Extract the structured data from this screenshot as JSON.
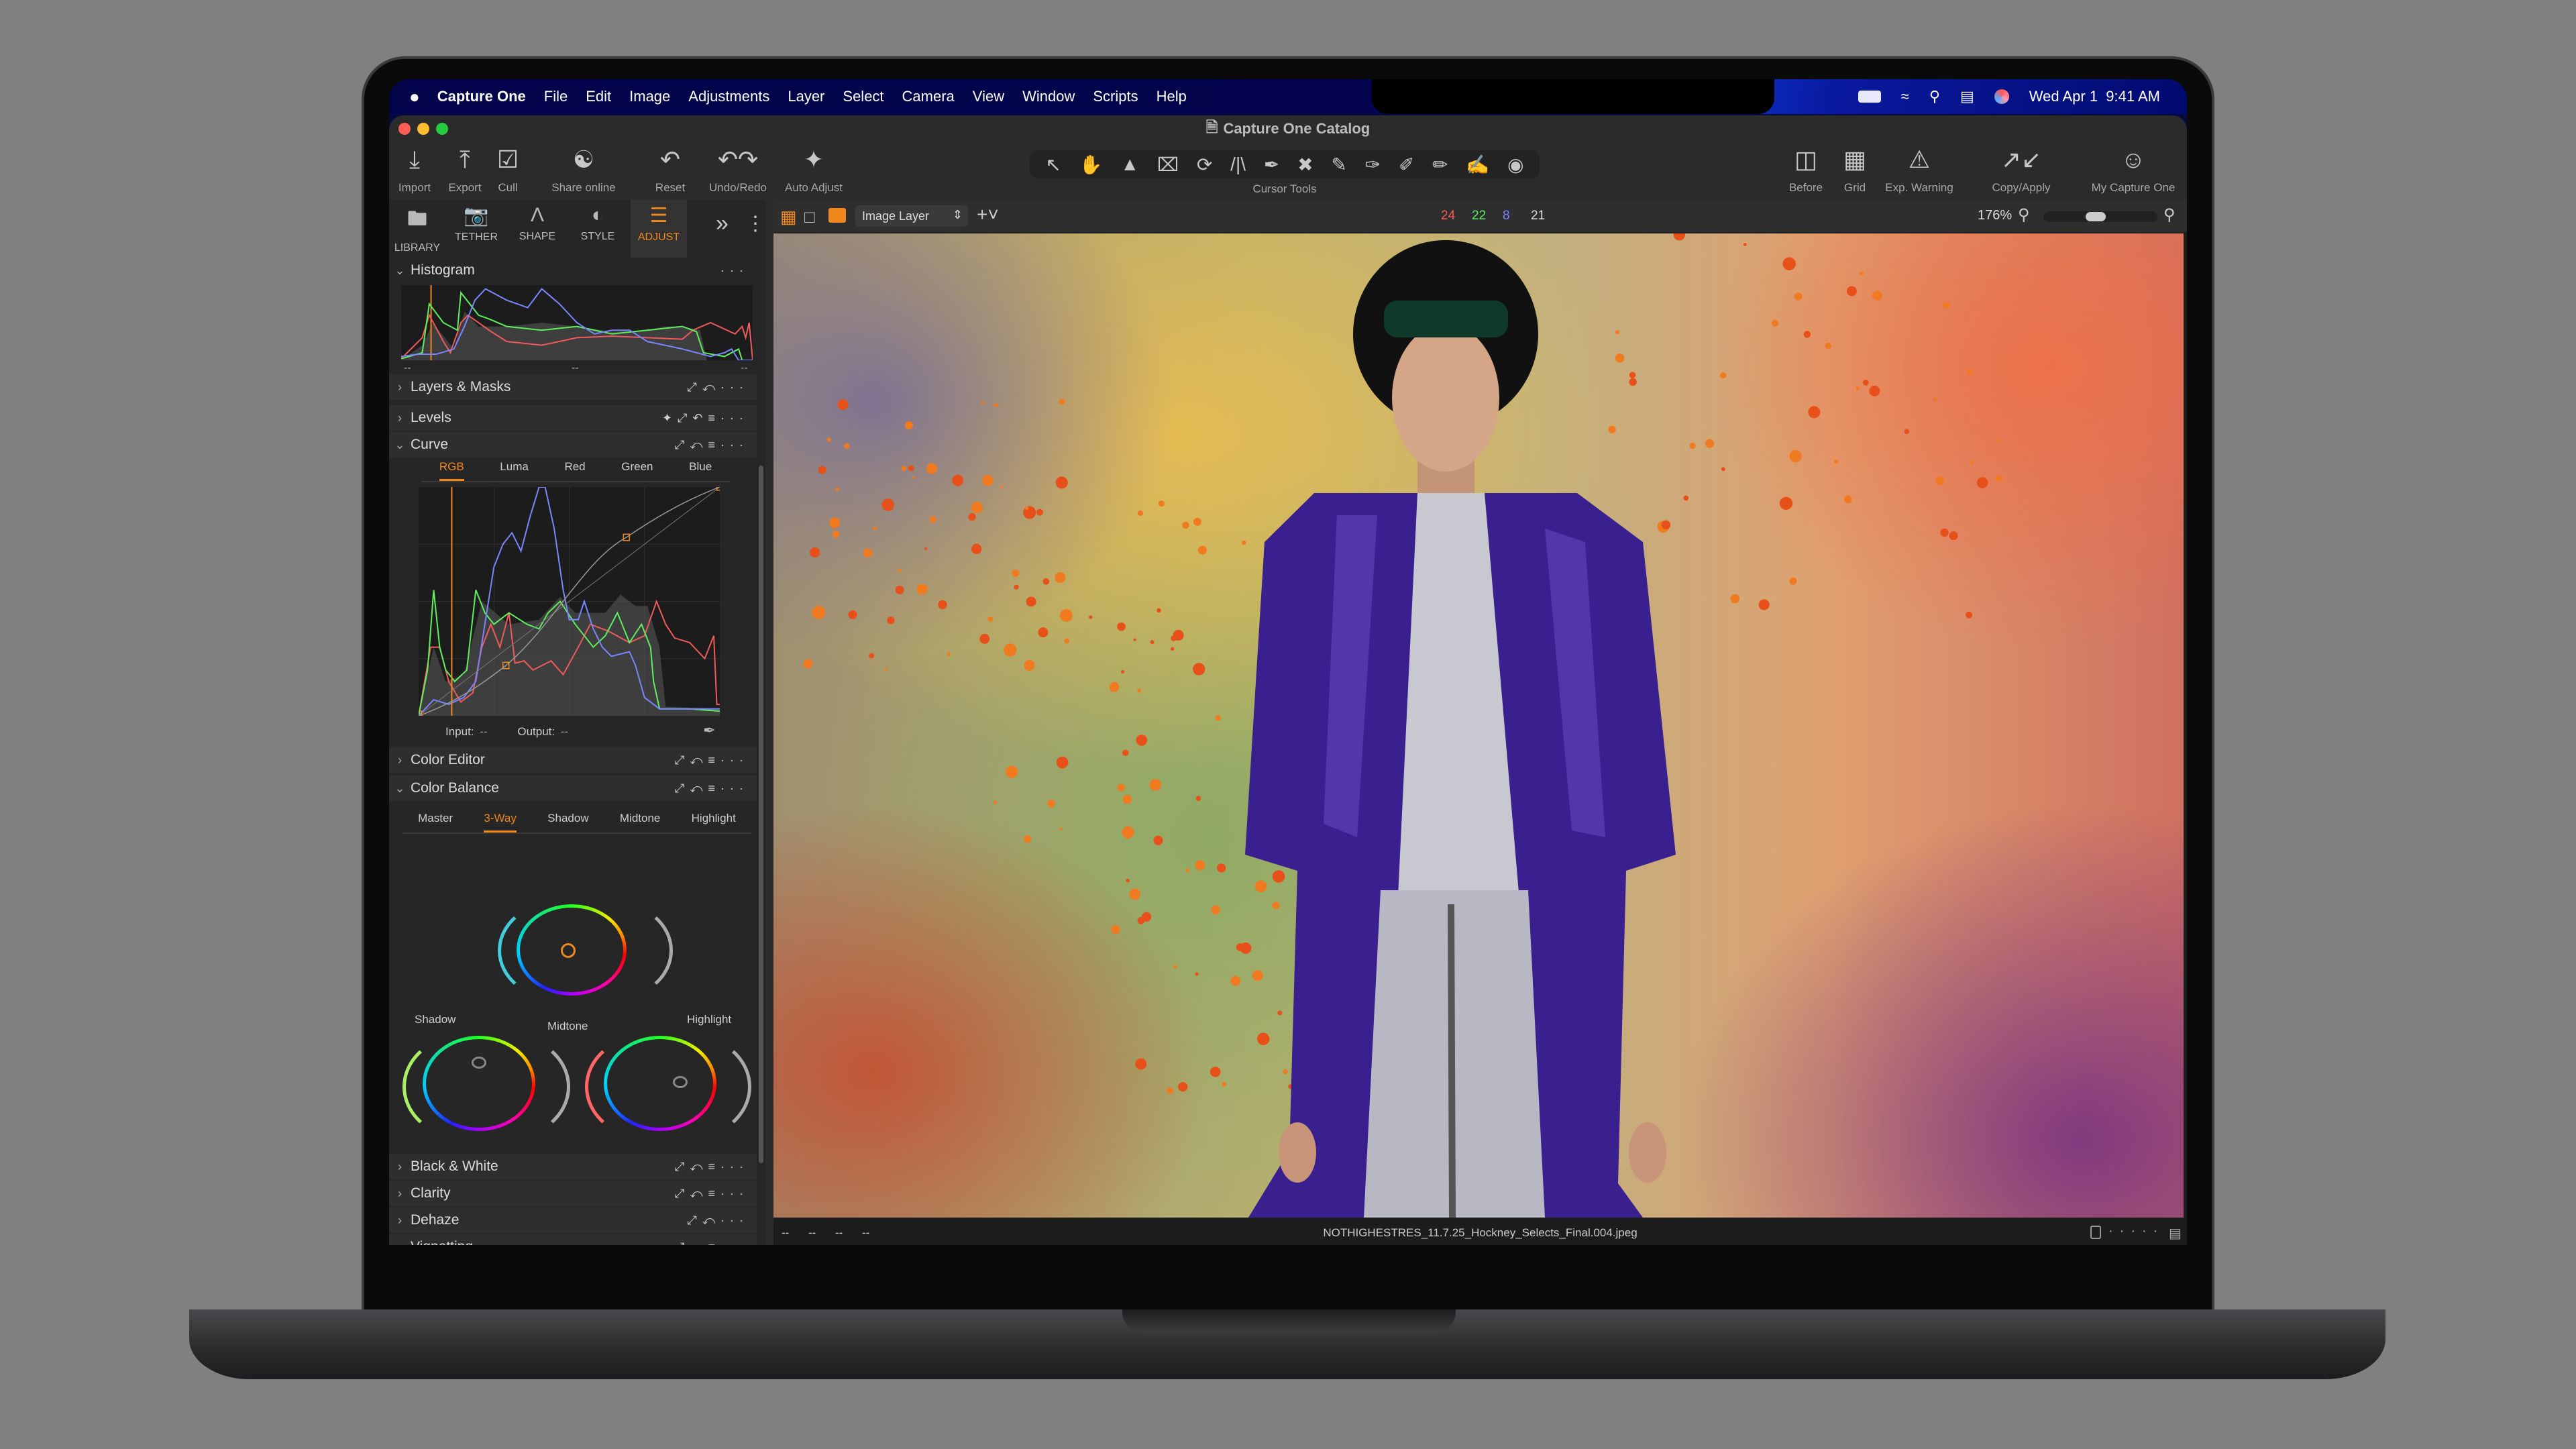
{
  "menubar": {
    "apple_icon": "apple-logo",
    "app_name": "Capture One",
    "items": [
      "File",
      "Edit",
      "Image",
      "Adjustments",
      "Layer",
      "Select",
      "Camera",
      "View",
      "Window",
      "Scripts",
      "Help"
    ],
    "status_icons": [
      "battery-icon",
      "wifi-icon",
      "search-icon",
      "control-center-icon",
      "siri-icon"
    ],
    "datetime": "Wed Apr 1  9:41 AM"
  },
  "window": {
    "title": "Capture One Catalog"
  },
  "toolbar": {
    "left": [
      {
        "icon": "import-icon",
        "label": "Import"
      },
      {
        "icon": "export-icon",
        "label": "Export"
      },
      {
        "icon": "cull-icon",
        "label": "Cull"
      },
      {
        "icon": "share-icon",
        "label": "Share online"
      },
      {
        "icon": "reset-icon",
        "label": "Reset"
      },
      {
        "icon": "undo-redo-icon",
        "label": "Undo/Redo"
      },
      {
        "icon": "auto-adjust-icon",
        "label": "Auto Adjust"
      }
    ],
    "cursor_tools_label": "Cursor Tools",
    "right": [
      {
        "icon": "before-icon",
        "label": "Before"
      },
      {
        "icon": "grid-icon",
        "label": "Grid"
      },
      {
        "icon": "exposure-warning-icon",
        "label": "Exp. Warning"
      },
      {
        "icon": "copy-apply-icon",
        "label": "Copy/Apply"
      },
      {
        "icon": "user-icon",
        "label": "My Capture One"
      }
    ]
  },
  "tool_tabs": [
    {
      "label": "LIBRARY",
      "active": false
    },
    {
      "label": "TETHER",
      "active": false
    },
    {
      "label": "SHAPE",
      "active": false
    },
    {
      "label": "STYLE",
      "active": false
    },
    {
      "label": "ADJUST",
      "active": true
    }
  ],
  "viewer_bar": {
    "layer_select": "Image Layer",
    "rgb_readout": {
      "r": "24",
      "g": "22",
      "b": "8",
      "l": "21"
    },
    "zoom": "176%",
    "zoom_slider_fraction": 0.45
  },
  "panel": {
    "histogram": {
      "title": "Histogram",
      "labels": [
        "--",
        "--",
        "--"
      ]
    },
    "layers_masks": "Layers & Masks",
    "levels": "Levels",
    "curve": {
      "title": "Curve",
      "tabs": [
        "RGB",
        "Luma",
        "Red",
        "Green",
        "Blue"
      ],
      "active_tab": "RGB",
      "input_label": "Input:",
      "input_value": "--",
      "output_label": "Output:",
      "output_value": "--"
    },
    "color_editor": "Color Editor",
    "color_balance": {
      "title": "Color Balance",
      "tabs": [
        "Master",
        "3-Way",
        "Shadow",
        "Midtone",
        "Highlight"
      ],
      "active_tab": "3-Way",
      "wheel_labels": {
        "shadow": "Shadow",
        "midtone": "Midtone",
        "highlight": "Highlight"
      }
    },
    "collapsed_sections": [
      "Black & White",
      "Clarity",
      "Dehaze",
      "Vignetting"
    ]
  },
  "bottom_bar": {
    "readouts": [
      "--",
      "--",
      "--",
      "--"
    ],
    "filename": "NOTHIGHESTRES_11.7.25_Hockney_Selects_Final.004.jpeg"
  },
  "colors": {
    "accent": "#f0881e",
    "background": "#808080",
    "panel": "#262626"
  }
}
